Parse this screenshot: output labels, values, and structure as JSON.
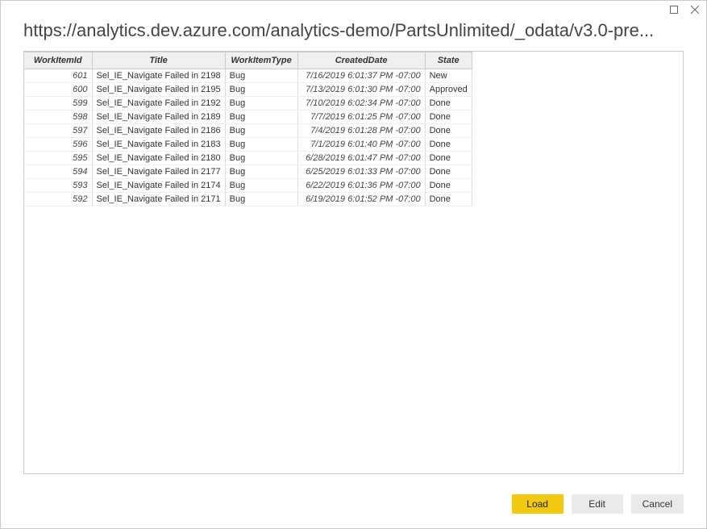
{
  "url": "https://analytics.dev.azure.com/analytics-demo/PartsUnlimited/_odata/v3.0-pre...",
  "columns": [
    "WorkItemId",
    "Title",
    "WorkItemType",
    "CreatedDate",
    "State"
  ],
  "rows": [
    {
      "id": "601",
      "title": "Sel_IE_Navigate Failed in 2198",
      "type": "Bug",
      "date": "7/16/2019 6:01:37 PM -07:00",
      "state": "New"
    },
    {
      "id": "600",
      "title": "Sel_IE_Navigate Failed in 2195",
      "type": "Bug",
      "date": "7/13/2019 6:01:30 PM -07:00",
      "state": "Approved"
    },
    {
      "id": "599",
      "title": "Sel_IE_Navigate Failed in 2192",
      "type": "Bug",
      "date": "7/10/2019 6:02:34 PM -07:00",
      "state": "Done"
    },
    {
      "id": "598",
      "title": "Sel_IE_Navigate Failed in 2189",
      "type": "Bug",
      "date": "7/7/2019 6:01:25 PM -07:00",
      "state": "Done"
    },
    {
      "id": "597",
      "title": "Sel_IE_Navigate Failed in 2186",
      "type": "Bug",
      "date": "7/4/2019 6:01:28 PM -07:00",
      "state": "Done"
    },
    {
      "id": "596",
      "title": "Sel_IE_Navigate Failed in 2183",
      "type": "Bug",
      "date": "7/1/2019 6:01:40 PM -07:00",
      "state": "Done"
    },
    {
      "id": "595",
      "title": "Sel_IE_Navigate Failed in 2180",
      "type": "Bug",
      "date": "6/28/2019 6:01:47 PM -07:00",
      "state": "Done"
    },
    {
      "id": "594",
      "title": "Sel_IE_Navigate Failed in 2177",
      "type": "Bug",
      "date": "6/25/2019 6:01:33 PM -07:00",
      "state": "Done"
    },
    {
      "id": "593",
      "title": "Sel_IE_Navigate Failed in 2174",
      "type": "Bug",
      "date": "6/22/2019 6:01:36 PM -07:00",
      "state": "Done"
    },
    {
      "id": "592",
      "title": "Sel_IE_Navigate Failed in 2171",
      "type": "Bug",
      "date": "6/19/2019 6:01:52 PM -07:00",
      "state": "Done"
    }
  ],
  "buttons": {
    "load": "Load",
    "edit": "Edit",
    "cancel": "Cancel"
  }
}
